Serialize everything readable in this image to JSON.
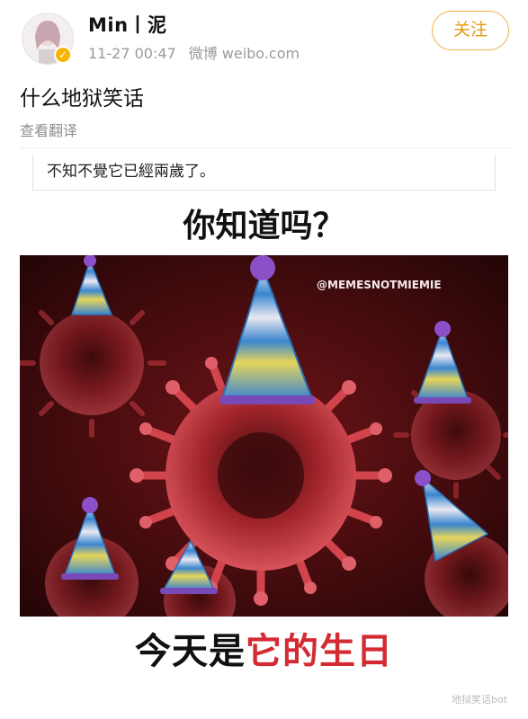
{
  "post": {
    "username": "Min丨泥",
    "time": "11-27 00:47",
    "source": "微博 weibo.com",
    "follow_label": "关注",
    "text": "什么地狱笑话",
    "translate_label": "查看翻译"
  },
  "meme": {
    "snippet_text": "不知不覺它已經兩歲了。",
    "question": "你知道吗？",
    "watermark_handle": "@MEMESNOTMIEMIE",
    "caption_black": "今天是",
    "caption_red": "它的生日"
  },
  "watermark": "地狱笑话bot",
  "colors": {
    "accent": "#e39a10",
    "caption_red": "#d42a32",
    "virus_red": "#b3262b",
    "background_dark": "#3a0a0c"
  }
}
